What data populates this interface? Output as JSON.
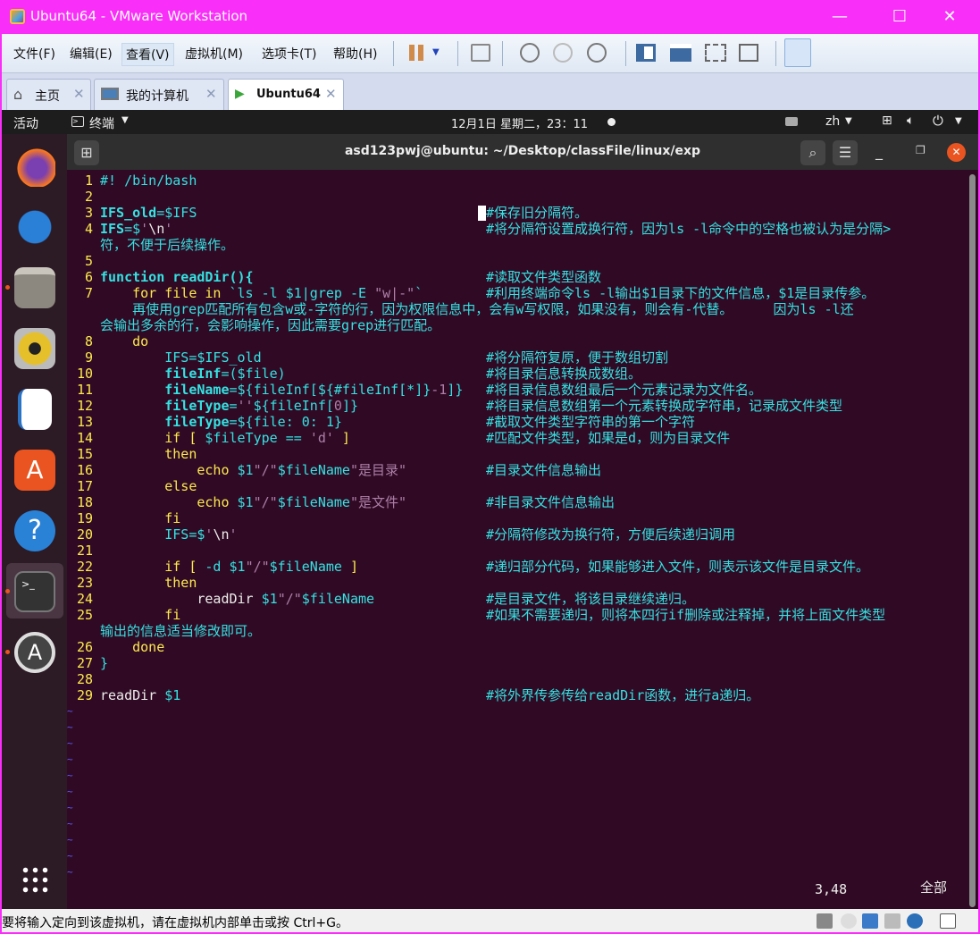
{
  "window": {
    "title": "Ubuntu64 - VMware Workstation",
    "minimize": "—",
    "maximize": "☐",
    "close": "✕"
  },
  "menu": [
    "文件(F)",
    "编辑(E)",
    "查看(V)",
    "虚拟机(M)",
    "选项卡(T)",
    "帮助(H)"
  ],
  "tabs": [
    {
      "label": "主页",
      "icon": "home-icon"
    },
    {
      "label": "我的计算机",
      "icon": "monitor-icon"
    },
    {
      "label": "Ubuntu64",
      "icon": "vm-icon"
    }
  ],
  "tab_close": "✕",
  "gnome": {
    "activities": "活动",
    "app": "终端",
    "clock": "12月1日 星期二，23：11",
    "lang": "zh"
  },
  "terminal": {
    "title": "asd123pwj@ubuntu: ~/Desktop/classFile/linux/exp",
    "position": "3,48",
    "scope": "全部"
  },
  "code": [
    {
      "n": "1",
      "seg": [
        [
          "c",
          "#! /bin/bash"
        ]
      ]
    },
    {
      "n": "2",
      "seg": []
    },
    {
      "n": "3",
      "seg": [
        [
          "v",
          "IFS_old"
        ],
        [
          "c",
          "=$IFS"
        ]
      ],
      "cmt": "#保存旧分隔符。",
      "cursor": true
    },
    {
      "n": "4",
      "seg": [
        [
          "v",
          "IFS"
        ],
        [
          "c",
          "=$"
        ],
        [
          "s",
          "'"
        ],
        [
          "w",
          "\\n"
        ],
        [
          "s",
          "'"
        ]
      ],
      "cmt": "#将分隔符设置成换行符，因为ls -l命令中的空格也被认为是分隔>"
    },
    {
      "n": "",
      "seg": [
        [
          "c",
          "符，不便于后续操作。"
        ]
      ]
    },
    {
      "n": "5",
      "seg": []
    },
    {
      "n": "6",
      "seg": [
        [
          "v",
          "function readDir(){"
        ]
      ],
      "cmt": "#读取文件类型函数"
    },
    {
      "n": "7",
      "seg": [
        [
          "k",
          "    for file in "
        ],
        [
          "c",
          "`ls -l $1|grep -E "
        ],
        [
          "s",
          "\"w|-\""
        ],
        [
          "c",
          "`"
        ]
      ],
      "cmt": "#利用终端命令ls -l输出$1目录下的文件信息，$1是目录传参。"
    },
    {
      "n": "",
      "seg": [
        [
          "c",
          "    再使用grep匹配所有包含w或-字符的行，因为权限信息中，会有w写权限，如果没有，则会有-代替。     因为ls -l还"
        ]
      ]
    },
    {
      "n": "",
      "seg": [
        [
          "c",
          "会输出多余的行，会影响操作，因此需要grep进行匹配。"
        ]
      ]
    },
    {
      "n": "8",
      "seg": [
        [
          "k",
          "    do"
        ]
      ]
    },
    {
      "n": "9",
      "seg": [
        [
          "c",
          "        IFS=$IFS_old"
        ]
      ],
      "cmt": "#将分隔符复原，便于数组切割"
    },
    {
      "n": "10",
      "seg": [
        [
          "v",
          "        fileInf"
        ],
        [
          "c",
          "=($file)"
        ]
      ],
      "cmt": "#将目录信息转换成数组。"
    },
    {
      "n": "11",
      "seg": [
        [
          "v",
          "        fileName"
        ],
        [
          "c",
          "=${fileInf[${#fileInf[*]}"
        ],
        [
          "s",
          "-1"
        ],
        [
          "c",
          "]}"
        ]
      ],
      "cmt": "#将目录信息数组最后一个元素记录为文件名。"
    },
    {
      "n": "12",
      "seg": [
        [
          "v",
          "        fileType"
        ],
        [
          "c",
          "="
        ],
        [
          "s",
          "''"
        ],
        [
          "c",
          "${fileInf["
        ],
        [
          "s",
          "0"
        ],
        [
          "c",
          "]}"
        ]
      ],
      "cmt": "#将目录信息数组第一个元素转换成字符串，记录成文件类型"
    },
    {
      "n": "13",
      "seg": [
        [
          "v",
          "        fileType"
        ],
        [
          "c",
          "=${file: 0: 1}"
        ]
      ],
      "cmt": "#截取文件类型字符串的第一个字符"
    },
    {
      "n": "14",
      "seg": [
        [
          "k",
          "        if [ "
        ],
        [
          "c",
          "$fileType == "
        ],
        [
          "s",
          "'d'"
        ],
        [
          "k",
          " ]"
        ]
      ],
      "cmt": "#匹配文件类型，如果是d，则为目录文件"
    },
    {
      "n": "15",
      "seg": [
        [
          "k",
          "        then"
        ]
      ]
    },
    {
      "n": "16",
      "seg": [
        [
          "k",
          "            echo "
        ],
        [
          "c",
          "$1"
        ],
        [
          "s",
          "\"/\""
        ],
        [
          "c",
          "$fileName"
        ],
        [
          "s",
          "\"是目录\""
        ]
      ],
      "cmt": "#目录文件信息输出"
    },
    {
      "n": "17",
      "seg": [
        [
          "k",
          "        else"
        ]
      ]
    },
    {
      "n": "18",
      "seg": [
        [
          "k",
          "            echo "
        ],
        [
          "c",
          "$1"
        ],
        [
          "s",
          "\"/\""
        ],
        [
          "c",
          "$fileName"
        ],
        [
          "s",
          "\"是文件\""
        ]
      ],
      "cmt": "#非目录文件信息输出"
    },
    {
      "n": "19",
      "seg": [
        [
          "k",
          "        fi"
        ]
      ]
    },
    {
      "n": "20",
      "seg": [
        [
          "c",
          "        IFS=$"
        ],
        [
          "s",
          "'"
        ],
        [
          "w",
          "\\n"
        ],
        [
          "s",
          "'"
        ]
      ],
      "cmt": "#分隔符修改为换行符，方便后续递归调用"
    },
    {
      "n": "21",
      "seg": []
    },
    {
      "n": "22",
      "seg": [
        [
          "k",
          "        if [ "
        ],
        [
          "c",
          "-d $1"
        ],
        [
          "s",
          "\"/\""
        ],
        [
          "c",
          "$fileName "
        ],
        [
          "k",
          "]"
        ]
      ],
      "cmt": "#递归部分代码，如果能够进入文件，则表示该文件是目录文件。"
    },
    {
      "n": "23",
      "seg": [
        [
          "k",
          "        then"
        ]
      ]
    },
    {
      "n": "24",
      "seg": [
        [
          "w",
          "            readDir "
        ],
        [
          "c",
          "$1"
        ],
        [
          "s",
          "\"/\""
        ],
        [
          "c",
          "$fileName"
        ]
      ],
      "cmt": "#是目录文件，将该目录继续递归。"
    },
    {
      "n": "25",
      "seg": [
        [
          "k",
          "        fi"
        ]
      ],
      "cmt": "#如果不需要递归，则将本四行if删除或注释掉，并将上面文件类型"
    },
    {
      "n": "",
      "seg": [
        [
          "c",
          "输出的信息适当修改即可。"
        ]
      ]
    },
    {
      "n": "26",
      "seg": [
        [
          "k",
          "    done"
        ]
      ]
    },
    {
      "n": "27",
      "seg": [
        [
          "c",
          "}"
        ]
      ]
    },
    {
      "n": "28",
      "seg": []
    },
    {
      "n": "29",
      "seg": [
        [
          "w",
          "readDir "
        ],
        [
          "c",
          "$1"
        ]
      ],
      "cmt": "#将外界传参传给readDir函数，进行a递归。"
    }
  ],
  "tilde": "~",
  "tilde_rows": 11,
  "status": {
    "message": "要将输入定向到该虚拟机，请在虚拟机内部单击或按 Ctrl+G。"
  },
  "dock": [
    "firefox-icon",
    "thunderbird-icon",
    "files-icon",
    "rhythmbox-icon",
    "libreoffice-writer-icon",
    "software-center-icon",
    "help-icon",
    "terminal-icon",
    "software-updater-icon"
  ]
}
